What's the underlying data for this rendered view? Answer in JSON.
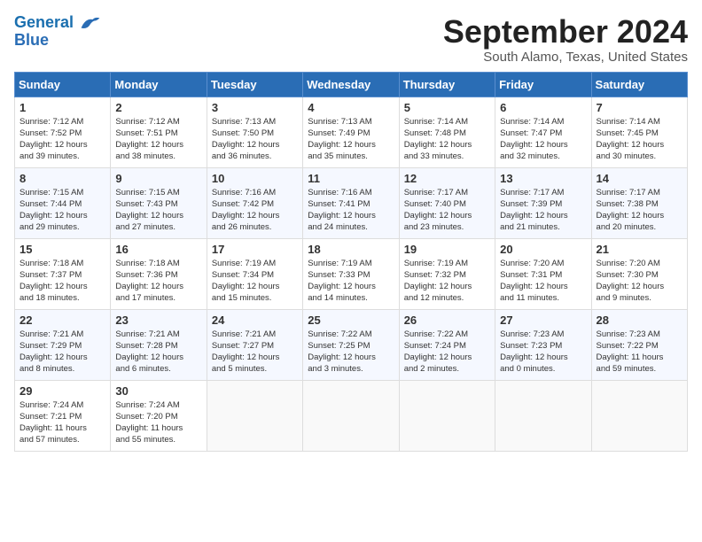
{
  "header": {
    "logo_line1": "General",
    "logo_line2": "Blue",
    "month_title": "September 2024",
    "location": "South Alamo, Texas, United States"
  },
  "calendar": {
    "days_of_week": [
      "Sunday",
      "Monday",
      "Tuesday",
      "Wednesday",
      "Thursday",
      "Friday",
      "Saturday"
    ],
    "weeks": [
      [
        {
          "day": "",
          "info": ""
        },
        {
          "day": "2",
          "info": "Sunrise: 7:12 AM\nSunset: 7:51 PM\nDaylight: 12 hours\nand 38 minutes."
        },
        {
          "day": "3",
          "info": "Sunrise: 7:13 AM\nSunset: 7:50 PM\nDaylight: 12 hours\nand 36 minutes."
        },
        {
          "day": "4",
          "info": "Sunrise: 7:13 AM\nSunset: 7:49 PM\nDaylight: 12 hours\nand 35 minutes."
        },
        {
          "day": "5",
          "info": "Sunrise: 7:14 AM\nSunset: 7:48 PM\nDaylight: 12 hours\nand 33 minutes."
        },
        {
          "day": "6",
          "info": "Sunrise: 7:14 AM\nSunset: 7:47 PM\nDaylight: 12 hours\nand 32 minutes."
        },
        {
          "day": "7",
          "info": "Sunrise: 7:14 AM\nSunset: 7:45 PM\nDaylight: 12 hours\nand 30 minutes."
        }
      ],
      [
        {
          "day": "8",
          "info": "Sunrise: 7:15 AM\nSunset: 7:44 PM\nDaylight: 12 hours\nand 29 minutes."
        },
        {
          "day": "9",
          "info": "Sunrise: 7:15 AM\nSunset: 7:43 PM\nDaylight: 12 hours\nand 27 minutes."
        },
        {
          "day": "10",
          "info": "Sunrise: 7:16 AM\nSunset: 7:42 PM\nDaylight: 12 hours\nand 26 minutes."
        },
        {
          "day": "11",
          "info": "Sunrise: 7:16 AM\nSunset: 7:41 PM\nDaylight: 12 hours\nand 24 minutes."
        },
        {
          "day": "12",
          "info": "Sunrise: 7:17 AM\nSunset: 7:40 PM\nDaylight: 12 hours\nand 23 minutes."
        },
        {
          "day": "13",
          "info": "Sunrise: 7:17 AM\nSunset: 7:39 PM\nDaylight: 12 hours\nand 21 minutes."
        },
        {
          "day": "14",
          "info": "Sunrise: 7:17 AM\nSunset: 7:38 PM\nDaylight: 12 hours\nand 20 minutes."
        }
      ],
      [
        {
          "day": "15",
          "info": "Sunrise: 7:18 AM\nSunset: 7:37 PM\nDaylight: 12 hours\nand 18 minutes."
        },
        {
          "day": "16",
          "info": "Sunrise: 7:18 AM\nSunset: 7:36 PM\nDaylight: 12 hours\nand 17 minutes."
        },
        {
          "day": "17",
          "info": "Sunrise: 7:19 AM\nSunset: 7:34 PM\nDaylight: 12 hours\nand 15 minutes."
        },
        {
          "day": "18",
          "info": "Sunrise: 7:19 AM\nSunset: 7:33 PM\nDaylight: 12 hours\nand 14 minutes."
        },
        {
          "day": "19",
          "info": "Sunrise: 7:19 AM\nSunset: 7:32 PM\nDaylight: 12 hours\nand 12 minutes."
        },
        {
          "day": "20",
          "info": "Sunrise: 7:20 AM\nSunset: 7:31 PM\nDaylight: 12 hours\nand 11 minutes."
        },
        {
          "day": "21",
          "info": "Sunrise: 7:20 AM\nSunset: 7:30 PM\nDaylight: 12 hours\nand 9 minutes."
        }
      ],
      [
        {
          "day": "22",
          "info": "Sunrise: 7:21 AM\nSunset: 7:29 PM\nDaylight: 12 hours\nand 8 minutes."
        },
        {
          "day": "23",
          "info": "Sunrise: 7:21 AM\nSunset: 7:28 PM\nDaylight: 12 hours\nand 6 minutes."
        },
        {
          "day": "24",
          "info": "Sunrise: 7:21 AM\nSunset: 7:27 PM\nDaylight: 12 hours\nand 5 minutes."
        },
        {
          "day": "25",
          "info": "Sunrise: 7:22 AM\nSunset: 7:25 PM\nDaylight: 12 hours\nand 3 minutes."
        },
        {
          "day": "26",
          "info": "Sunrise: 7:22 AM\nSunset: 7:24 PM\nDaylight: 12 hours\nand 2 minutes."
        },
        {
          "day": "27",
          "info": "Sunrise: 7:23 AM\nSunset: 7:23 PM\nDaylight: 12 hours\nand 0 minutes."
        },
        {
          "day": "28",
          "info": "Sunrise: 7:23 AM\nSunset: 7:22 PM\nDaylight: 11 hours\nand 59 minutes."
        }
      ],
      [
        {
          "day": "29",
          "info": "Sunrise: 7:24 AM\nSunset: 7:21 PM\nDaylight: 11 hours\nand 57 minutes."
        },
        {
          "day": "30",
          "info": "Sunrise: 7:24 AM\nSunset: 7:20 PM\nDaylight: 11 hours\nand 55 minutes."
        },
        {
          "day": "",
          "info": ""
        },
        {
          "day": "",
          "info": ""
        },
        {
          "day": "",
          "info": ""
        },
        {
          "day": "",
          "info": ""
        },
        {
          "day": "",
          "info": ""
        }
      ]
    ],
    "week1_sunday": {
      "day": "1",
      "info": "Sunrise: 7:12 AM\nSunset: 7:52 PM\nDaylight: 12 hours\nand 39 minutes."
    }
  }
}
